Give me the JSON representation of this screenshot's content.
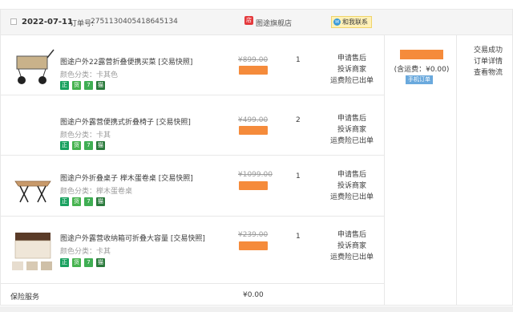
{
  "header": {
    "date": "2022-07-11",
    "order_label": "订单号:",
    "order_no": "2751130405418645134",
    "shop_name": "图途旗舰店",
    "contact_label": "和我联系"
  },
  "items": [
    {
      "title": "图途户外22露营折叠便携买菜 [交易快照]",
      "sku": "颜色分类：卡其色",
      "price_old": "¥899.00",
      "qty": "1",
      "actions": [
        "申请售后",
        "投诉商家",
        "运费险已出单"
      ]
    },
    {
      "title": "图途户外露营便携式折叠椅子 [交易快照]",
      "sku": "颜色分类：卡其",
      "price_old": "¥499.00",
      "qty": "2",
      "actions": [
        "申请售后",
        "投诉商家",
        "运费险已出单"
      ]
    },
    {
      "title": "图途户外折叠桌子 榉木蛋卷桌 [交易快照]",
      "sku": "颜色分类：榉木蛋卷桌",
      "price_old": "¥1099.00",
      "qty": "1",
      "actions": [
        "申请售后",
        "投诉商家",
        "运费险已出单"
      ]
    },
    {
      "title": "图途户外露营收纳箱可折叠大容量 [交易快照]",
      "sku": "颜色分类：卡其",
      "price_old": "¥239.00",
      "qty": "1",
      "actions": [
        "申请售后",
        "投诉商家",
        "运费险已出单"
      ]
    }
  ],
  "badges": [
    "正",
    "货",
    "7",
    "猫"
  ],
  "summary": {
    "freight": "(含运费：¥0.00)",
    "mobile_order": "手机订单"
  },
  "status": {
    "lines": [
      "交易成功",
      "订单详情",
      "查看物流"
    ]
  },
  "insurance": {
    "label": "保险服务",
    "price": "¥0.00"
  },
  "colors": {
    "accent": "#f58b3b",
    "badge_green": "#19a15f",
    "link_blue": "#6aa9dd"
  }
}
